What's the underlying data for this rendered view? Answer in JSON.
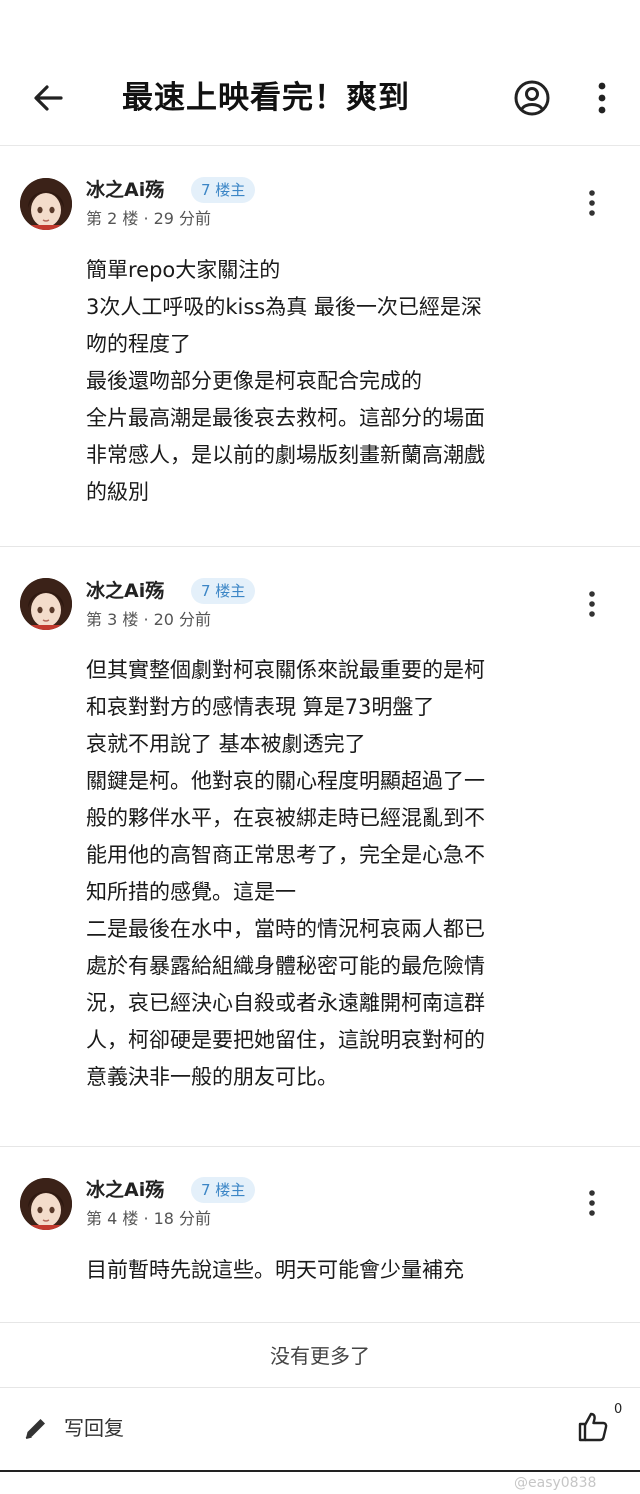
{
  "header": {
    "title": "最速上映看完！爽到",
    "back_icon": "arrow-left-icon",
    "account_icon": "account-circle-icon",
    "more_icon": "more-vertical-icon"
  },
  "posts": [
    {
      "author": "冰之Ai殇",
      "badge": "7 楼主",
      "meta": "第 2 楼 · 29 分前",
      "lines": [
        "簡單repo大家關注的",
        "3次人工呼吸的kiss為真 最後一次已經是深",
        "吻的程度了",
        "最後還吻部分更像是柯哀配合完成的",
        "全片最高潮是最後哀去救柯。這部分的場面",
        "非常感人，是以前的劇場版刻畫新蘭高潮戲",
        "的級別"
      ]
    },
    {
      "author": "冰之Ai殇",
      "badge": "7 楼主",
      "meta": "第 3 楼 · 20 分前",
      "lines": [
        "但其實整個劇對柯哀關係來說最重要的是柯",
        "和哀對對方的感情表現 算是73明盤了",
        "哀就不用說了 基本被劇透完了",
        "關鍵是柯。他對哀的關心程度明顯超過了一",
        "般的夥伴水平，在哀被綁走時已經混亂到不",
        "能用他的高智商正常思考了，完全是心急不",
        "知所措的感覺。這是一",
        "二是最後在水中，當時的情況柯哀兩人都已",
        "處於有暴露給組織身體秘密可能的最危險情",
        "況，哀已經決心自殺或者永遠離開柯南這群",
        "人，柯卻硬是要把她留住，這說明哀對柯的",
        "意義決非一般的朋友可比。"
      ]
    },
    {
      "author": "冰之Ai殇",
      "badge": "7 楼主",
      "meta": "第 4 楼 · 18 分前",
      "lines": [
        "目前暫時先說這些。明天可能會少量補充"
      ]
    }
  ],
  "footer_status": "没有更多了",
  "bottom_bar": {
    "reply_label": "写回复",
    "reply_icon": "pencil-icon",
    "like_icon": "thumbs-up-icon",
    "like_count": "0"
  },
  "watermark": "@easy0838"
}
